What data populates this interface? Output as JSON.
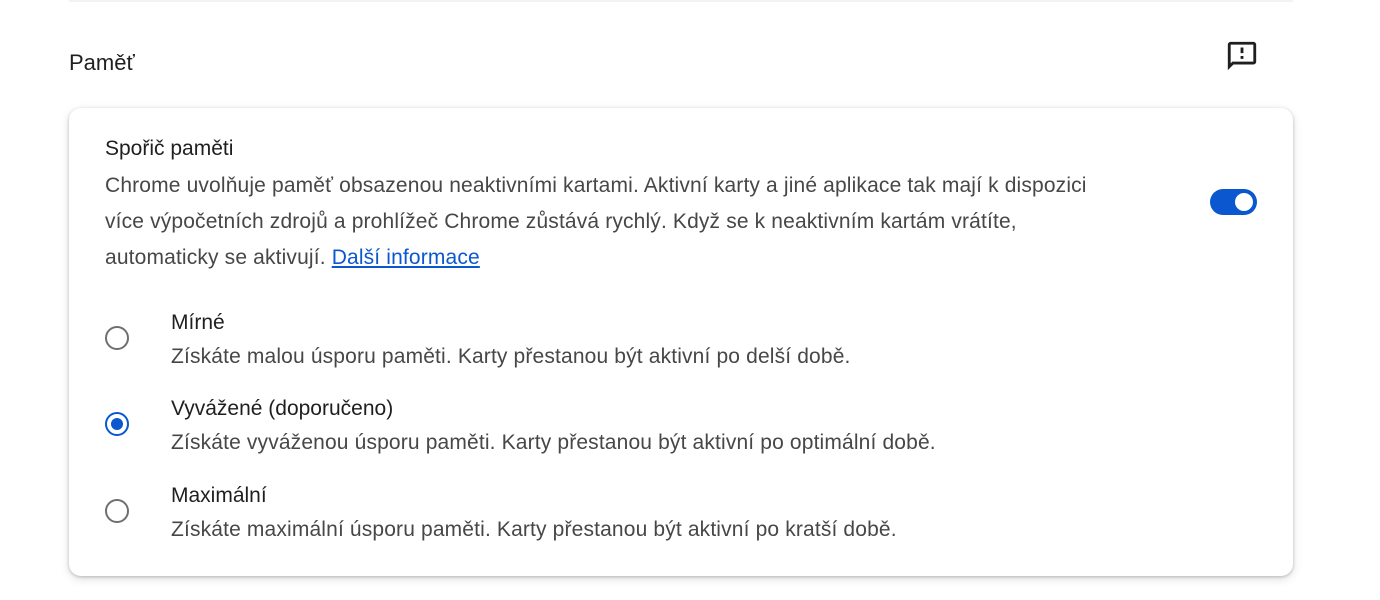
{
  "section": {
    "title": "Paměť",
    "feedback_icon": "feedback-icon"
  },
  "memory_saver": {
    "title": "Spořič paměti",
    "description": "Chrome uvolňuje paměť obsazenou neaktivními kartami. Aktivní karty a jiné aplikace tak mají k dispozici více výpočetních zdrojů a prohlížeč Chrome zůstává rychlý. Když se k neaktivním kartám vrátíte, automaticky se aktivují.",
    "learn_more": "Další informace",
    "enabled": true,
    "accent_color": "#0b57d0"
  },
  "options": [
    {
      "label": "Mírné",
      "description": "Získáte malou úsporu paměti. Karty přestanou být aktivní po delší době.",
      "checked": false
    },
    {
      "label": "Vyvážené (doporučeno)",
      "description": "Získáte vyváženou úsporu paměti. Karty přestanou být aktivní po optimální době.",
      "checked": true
    },
    {
      "label": "Maximální",
      "description": "Získáte maximální úsporu paměti. Karty přestanou být aktivní po kratší době.",
      "checked": false
    }
  ]
}
